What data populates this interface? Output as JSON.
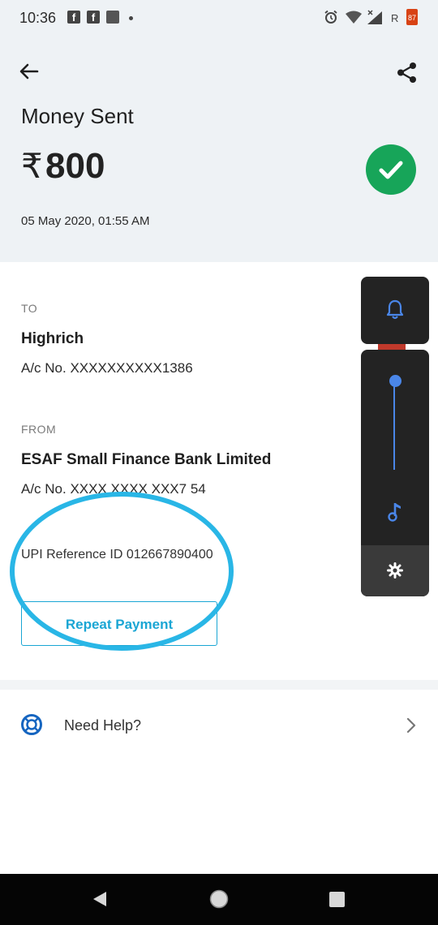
{
  "status_bar": {
    "time": "10:36",
    "battery": "87",
    "network_label": "R"
  },
  "header": {
    "title": "Money Sent",
    "currency_symbol": "₹",
    "amount": "800",
    "datetime": "05 May 2020, 01:55 AM"
  },
  "to": {
    "label": "TO",
    "name": "Highrich",
    "account": "A/c No. XXXXXXXXXX1386"
  },
  "from": {
    "label": "FROM",
    "name": "ESAF Small Finance Bank Limited",
    "account": "A/c No. XXXX XXXX XXX7 54"
  },
  "upi_reference": "UPI Reference ID 012667890400",
  "repeat_button_label": "Repeat Payment",
  "help": {
    "label": "Need Help?"
  },
  "colors": {
    "success_green": "#17a559",
    "accent_blue": "#1ba6d4",
    "annotation_circle": "#29b6e6",
    "volume_blue": "#4a86e8"
  },
  "icons": {
    "back": "arrow-left",
    "share": "share",
    "success": "checkmark",
    "help": "lifebuoy",
    "chevron": "chevron-right",
    "volume_ring": "bell",
    "volume_media": "music-note",
    "volume_settings": "gear"
  }
}
